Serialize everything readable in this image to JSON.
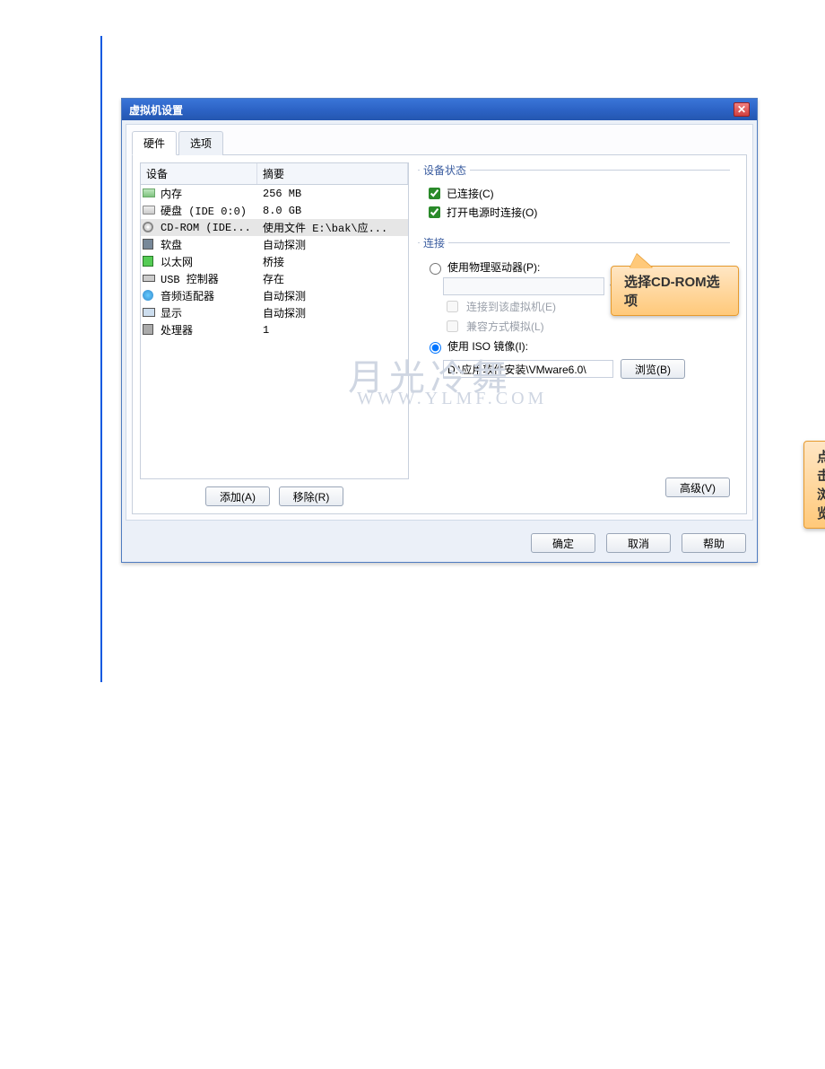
{
  "window": {
    "title": "虚拟机设置",
    "tabs": {
      "hardware": "硬件",
      "options": "选项"
    }
  },
  "device_list": {
    "col_device": "设备",
    "col_summary": "摘要",
    "rows": [
      {
        "name": "内存",
        "summary": "256 MB",
        "icon": "memory-icon"
      },
      {
        "name": "硬盘 (IDE 0:0)",
        "summary": "8.0 GB",
        "icon": "disk-icon"
      },
      {
        "name": "CD-ROM (IDE...",
        "summary": "使用文件 E:\\bak\\应...",
        "icon": "cdrom-icon",
        "selected": true
      },
      {
        "name": "软盘",
        "summary": "自动探测",
        "icon": "floppy-icon"
      },
      {
        "name": "以太网",
        "summary": "桥接",
        "icon": "ethernet-icon"
      },
      {
        "name": "USB 控制器",
        "summary": "存在",
        "icon": "usb-icon"
      },
      {
        "name": "音频适配器",
        "summary": "自动探测",
        "icon": "audio-icon"
      },
      {
        "name": "显示",
        "summary": "自动探测",
        "icon": "display-icon"
      },
      {
        "name": "处理器",
        "summary": "1",
        "icon": "cpu-icon"
      }
    ],
    "add_btn": "添加(A)",
    "remove_btn": "移除(R)"
  },
  "status_group": {
    "title": "设备状态",
    "connected": "已连接(C)",
    "connect_at_power_on": "打开电源时连接(O)"
  },
  "connection_group": {
    "title": "连接",
    "use_physical": "使用物理驱动器(P):",
    "physical_value": "",
    "connect_to_vm": "连接到该虚拟机(E)",
    "compat_mode": "兼容方式模拟(L)",
    "use_iso": "使用 ISO 镜像(I):",
    "iso_path": "D:\\应用软件安装\\VMware6.0\\",
    "browse_btn": "浏览(B)",
    "advanced_btn": "高级(V)"
  },
  "dialog_buttons": {
    "ok": "确定",
    "cancel": "取消",
    "help": "帮助"
  },
  "callouts": {
    "select_cdrom": "选择CD-ROM选项",
    "click_browse": "点击浏览"
  },
  "watermark": {
    "script": "月光冷舞",
    "url": "WWW.YLMF.COM"
  }
}
